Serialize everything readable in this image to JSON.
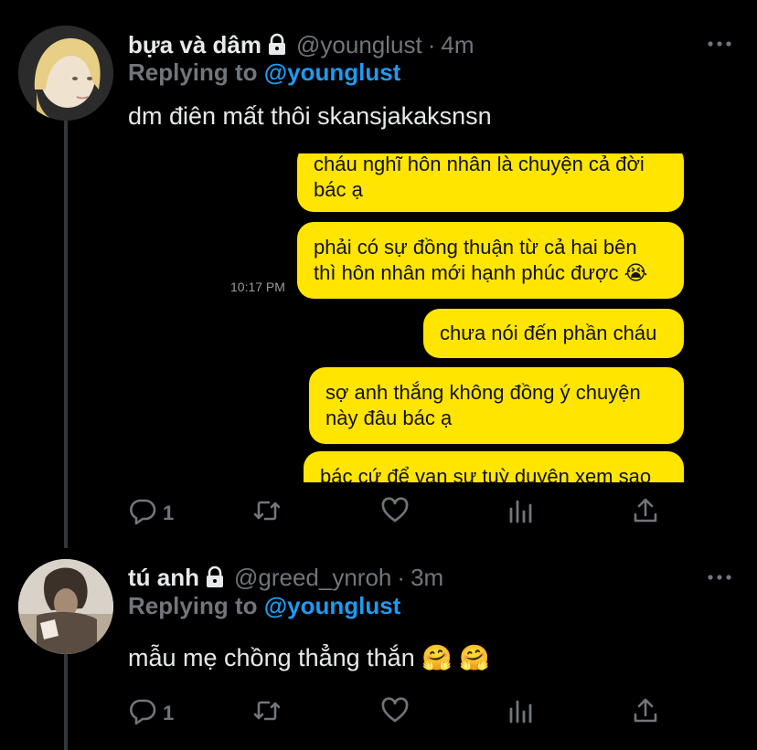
{
  "tweets": [
    {
      "display_name": "bựa và dâm",
      "handle": "@younglust",
      "separator": "·",
      "time": "4m",
      "replying_prefix": "Replying to ",
      "replying_mention": "@younglust",
      "text": "dm điên mất thôi skansjakaksnsn",
      "reply_count": "1",
      "media": {
        "time_label": "10:17 PM",
        "bubbles": [
          "cháu nghĩ hôn nhân là chuyện cả đời",
          "bác ạ",
          "phải có sự đồng thuận từ cả hai bên",
          "thì hôn nhân mới hạnh phúc được 😭",
          "chưa nói đến phần cháu",
          "sợ anh thắng không đồng ý chuyện",
          "này đâu bác ạ",
          "bác cứ để vạn sự tuỳ duyên xem sao"
        ]
      }
    },
    {
      "display_name": "tú anh",
      "handle": "@greed_ynroh",
      "separator": "·",
      "time": "3m",
      "replying_prefix": "Replying to ",
      "replying_mention": "@younglust",
      "text": "mẫu mẹ chồng thẳng thắn 🤗 🤗",
      "reply_count": "1"
    }
  ],
  "colors": {
    "background": "#000000",
    "text_primary": "#e7e9ea",
    "text_secondary": "#71767b",
    "mention": "#1d9bf0",
    "chat_bubble": "#ffe500"
  },
  "icons": [
    "lock-icon",
    "more-icon",
    "reply-icon",
    "retweet-icon",
    "like-icon",
    "analytics-icon",
    "share-icon"
  ]
}
